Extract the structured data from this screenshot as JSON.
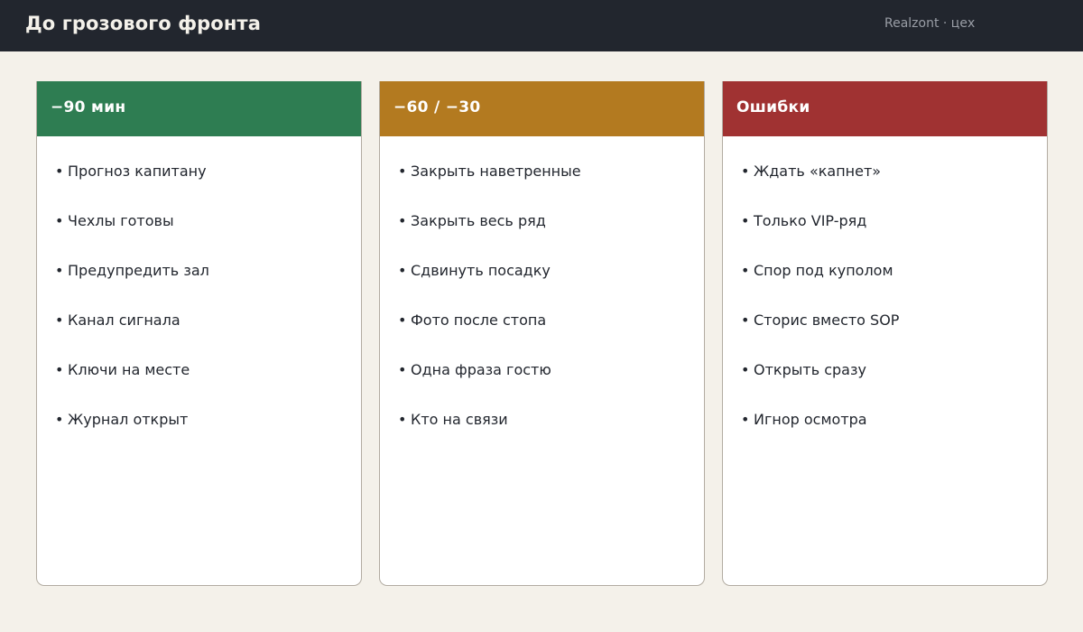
{
  "header": {
    "title": "До грозового фронта",
    "subtitle": "Realzont · цех"
  },
  "columns": [
    {
      "title": "−90 мин",
      "color": "#2e7d52",
      "items": [
        "Прогноз капитану",
        "Чехлы готовы",
        "Предупредить зал",
        "Канал сигнала",
        "Ключи на месте",
        "Журнал открыт"
      ]
    },
    {
      "title": "−60 / −30",
      "color": "#b37a20",
      "items": [
        "Закрыть наветренные",
        "Закрыть весь ряд",
        "Сдвинуть посадку",
        "Фото после стопа",
        "Одна фраза гостю",
        "Кто на связи"
      ]
    },
    {
      "title": "Ошибки",
      "color": "#a03232",
      "items": [
        "Ждать «капнет»",
        "Только VIP-ряд",
        "Спор под куполом",
        "Сторис вместо SOP",
        "Открыть сразу",
        "Игнор осмотра"
      ]
    }
  ],
  "bullet": "•"
}
